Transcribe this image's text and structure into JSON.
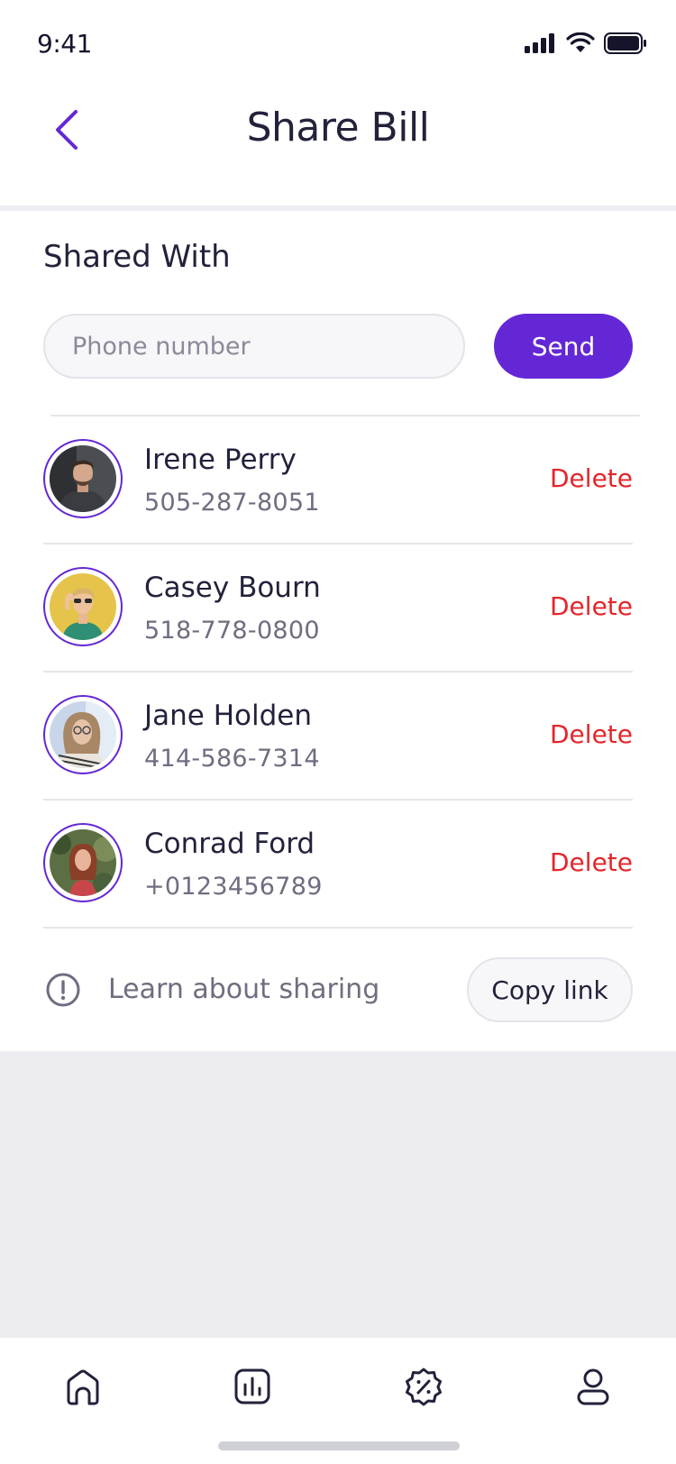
{
  "status_bar": {
    "time": "9:41"
  },
  "header": {
    "title": "Share Bill"
  },
  "section": {
    "title": "Shared With"
  },
  "phone_input": {
    "placeholder": "Phone number",
    "value": ""
  },
  "send_button": {
    "label": "Send"
  },
  "contacts": [
    {
      "name": "Irene Perry",
      "phone": "505-287-8051",
      "action": "Delete"
    },
    {
      "name": "Casey Bourn",
      "phone": "518-778-0800",
      "action": "Delete"
    },
    {
      "name": "Jane Holden",
      "phone": "414-586-7314",
      "action": "Delete"
    },
    {
      "name": "Conrad Ford",
      "phone": "+0123456789",
      "action": "Delete"
    }
  ],
  "footer": {
    "learn_label": "Learn about sharing",
    "copy_label": "Copy link"
  },
  "tabs": [
    {
      "icon": "home-icon"
    },
    {
      "icon": "chart-icon"
    },
    {
      "icon": "discount-icon"
    },
    {
      "icon": "profile-icon"
    }
  ],
  "colors": {
    "accent": "#6427d6",
    "danger": "#e5252a",
    "text": "#22223b",
    "muted": "#6e6e80"
  }
}
